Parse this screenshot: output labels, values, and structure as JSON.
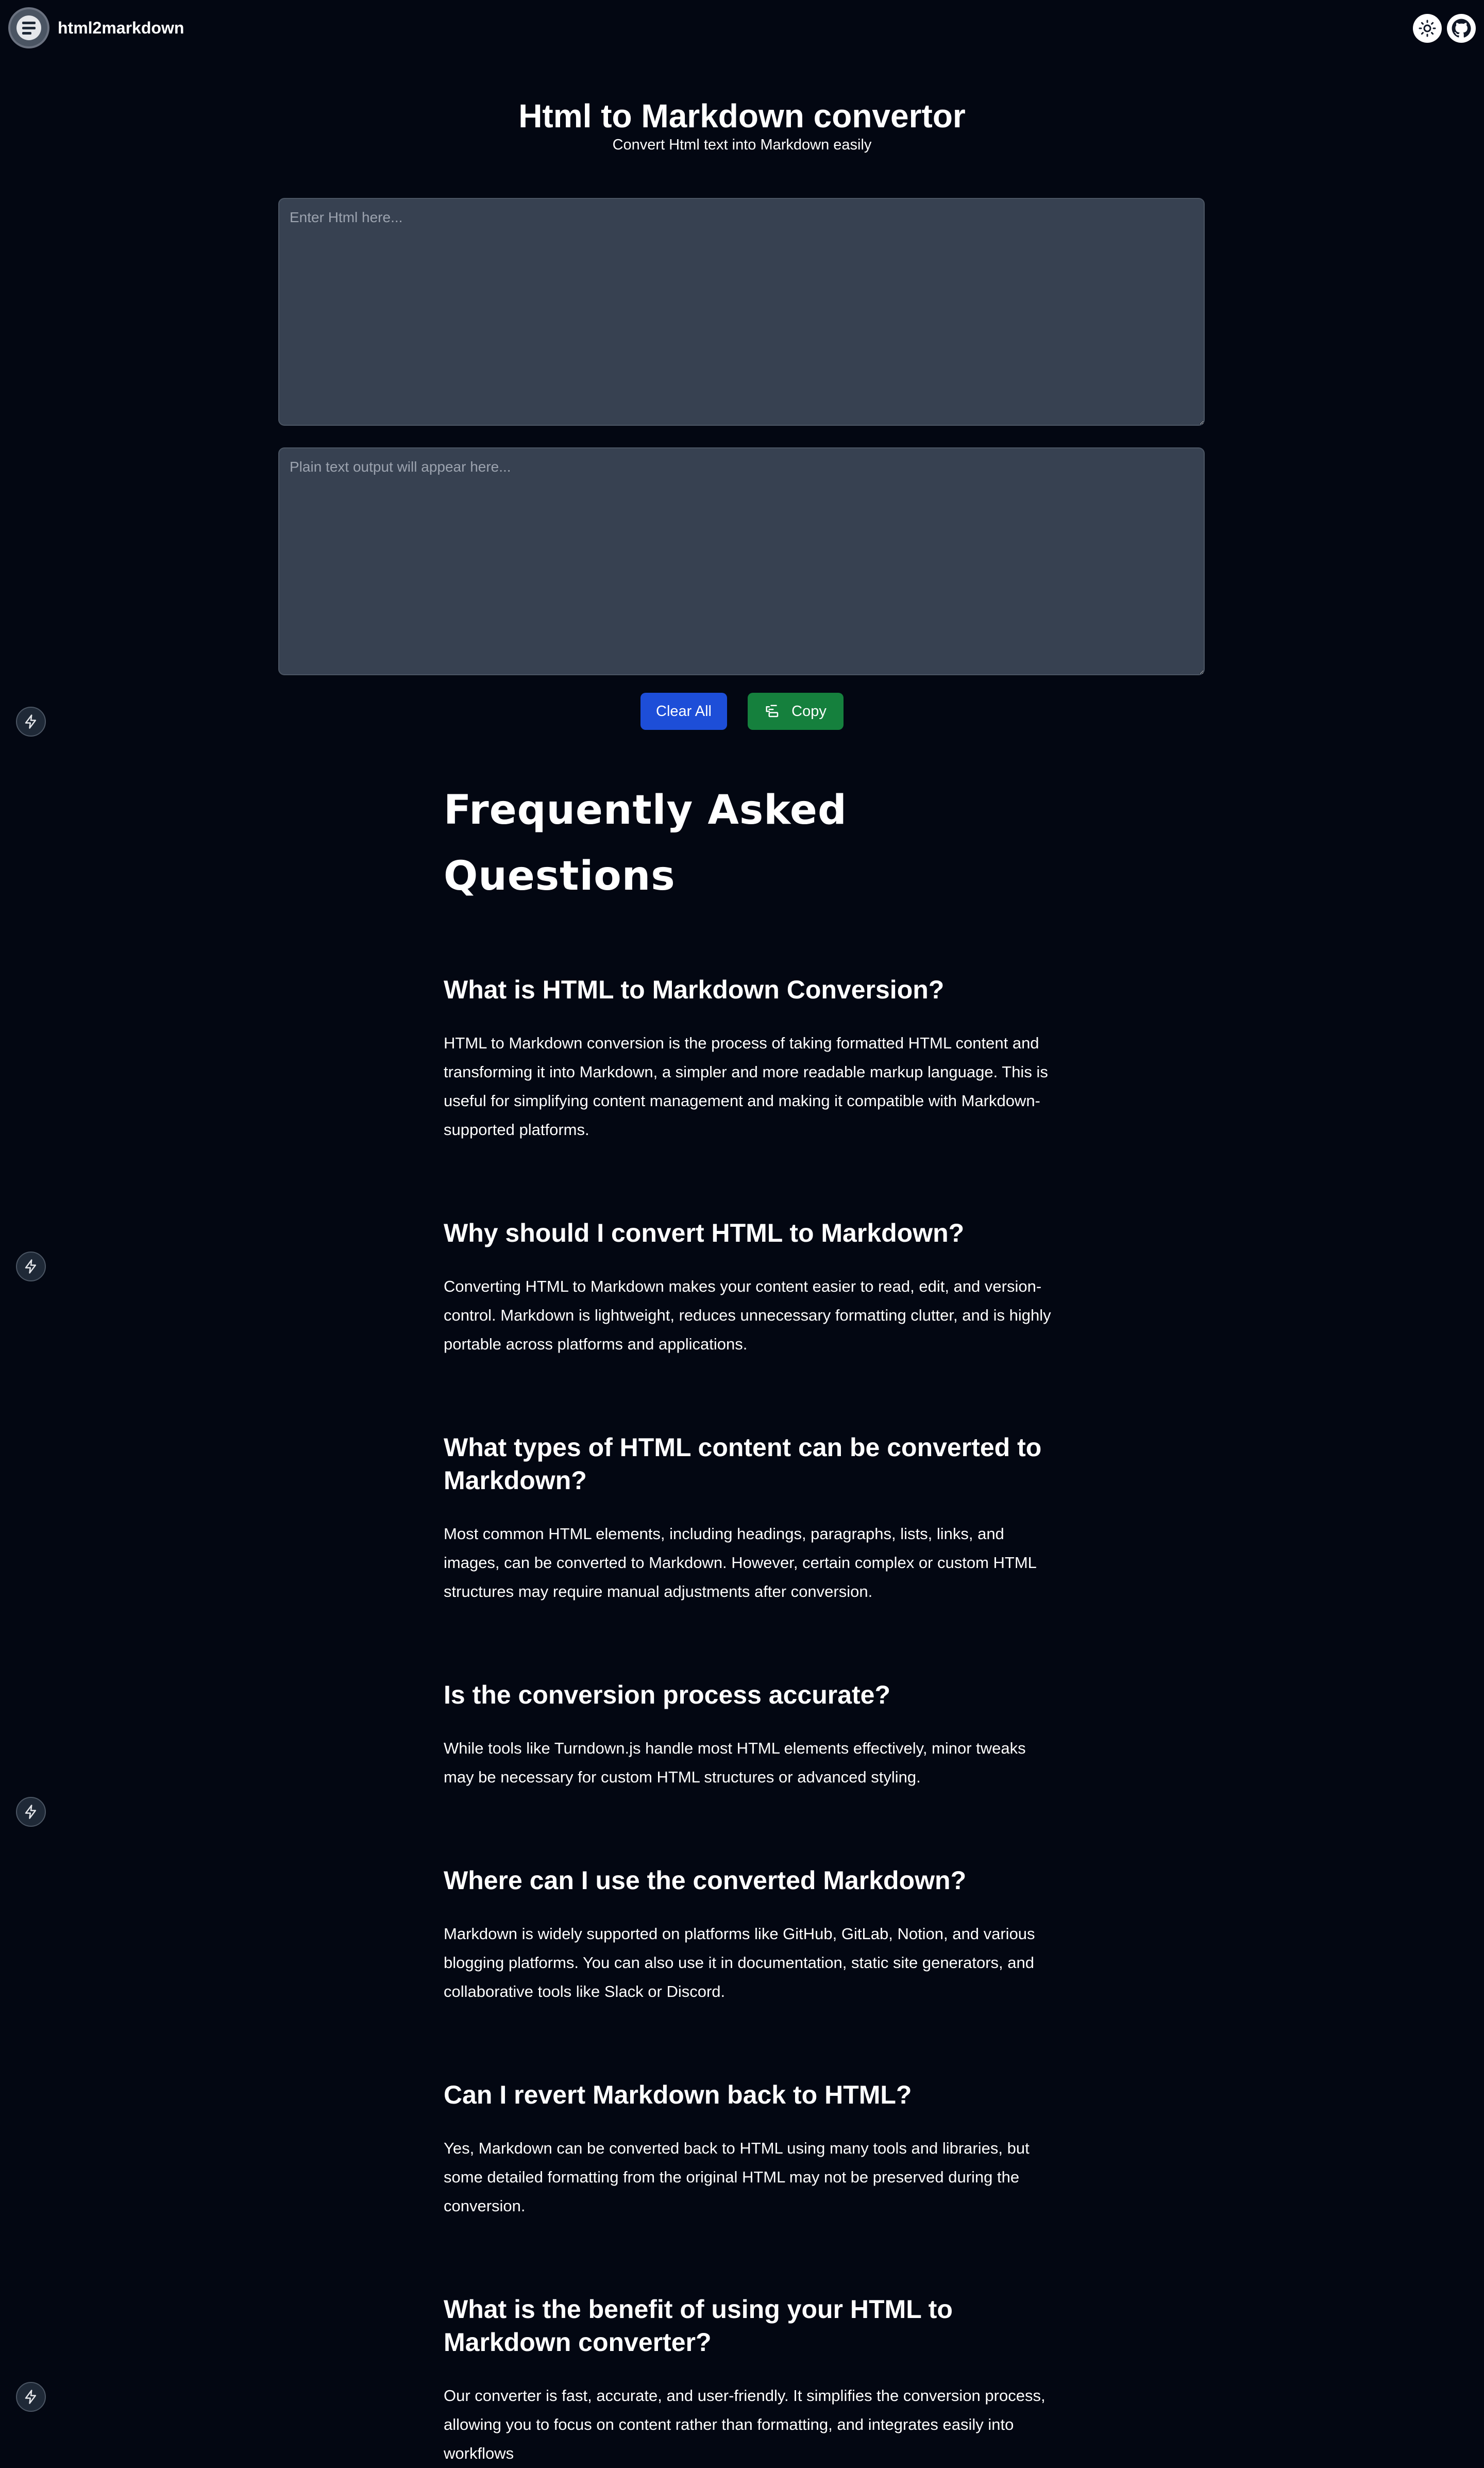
{
  "header": {
    "brand": "html2markdown",
    "theme_icon": "sun-icon",
    "github_icon": "github-icon"
  },
  "hero": {
    "title": "Html to Markdown convertor",
    "subtitle": "Convert Html text into Markdown easily"
  },
  "editor": {
    "input_placeholder": "Enter Html here...",
    "input_value": "",
    "output_placeholder": "Plain text output will appear here...",
    "output_value": ""
  },
  "actions": {
    "clear_label": "Clear All",
    "copy_label": "Copy",
    "copy_icon": "copy-icon"
  },
  "faq": {
    "title": "Frequently Asked Questions",
    "items": [
      {
        "question": "What is HTML to Markdown Conversion?",
        "answer": "HTML to Markdown conversion is the process of taking formatted HTML content and transforming it into Markdown, a simpler and more readable markup language. This is useful for simplifying content management and making it compatible with Markdown-supported platforms."
      },
      {
        "question": "Why should I convert HTML to Markdown?",
        "answer": "Converting HTML to Markdown makes your content easier to read, edit, and version-control. Markdown is lightweight, reduces unnecessary formatting clutter, and is highly portable across platforms and applications."
      },
      {
        "question": "What types of HTML content can be converted to Markdown?",
        "answer": "Most common HTML elements, including headings, paragraphs, lists, links, and images, can be converted to Markdown. However, certain complex or custom HTML structures may require manual adjustments after conversion."
      },
      {
        "question": "Is the conversion process accurate?",
        "answer": "While tools like Turndown.js handle most HTML elements effectively, minor tweaks may be necessary for custom HTML structures or advanced styling."
      },
      {
        "question": "Where can I use the converted Markdown?",
        "answer": "Markdown is widely supported on platforms like GitHub, GitLab, Notion, and various blogging platforms. You can also use it in documentation, static site generators, and collaborative tools like Slack or Discord."
      },
      {
        "question": "Can I revert Markdown back to HTML?",
        "answer": "Yes, Markdown can be converted back to HTML using many tools and libraries, but some detailed formatting from the original HTML may not be preserved during the conversion."
      },
      {
        "question": "What is the benefit of using your HTML to Markdown converter?",
        "answer": "Our converter is fast, accurate, and user-friendly. It simplifies the conversion process, allowing you to focus on content rather than formatting, and integrates easily into workflows"
      }
    ]
  },
  "side_icons": [
    "lightning-icon",
    "lightning-icon",
    "lightning-icon",
    "lightning-icon"
  ]
}
